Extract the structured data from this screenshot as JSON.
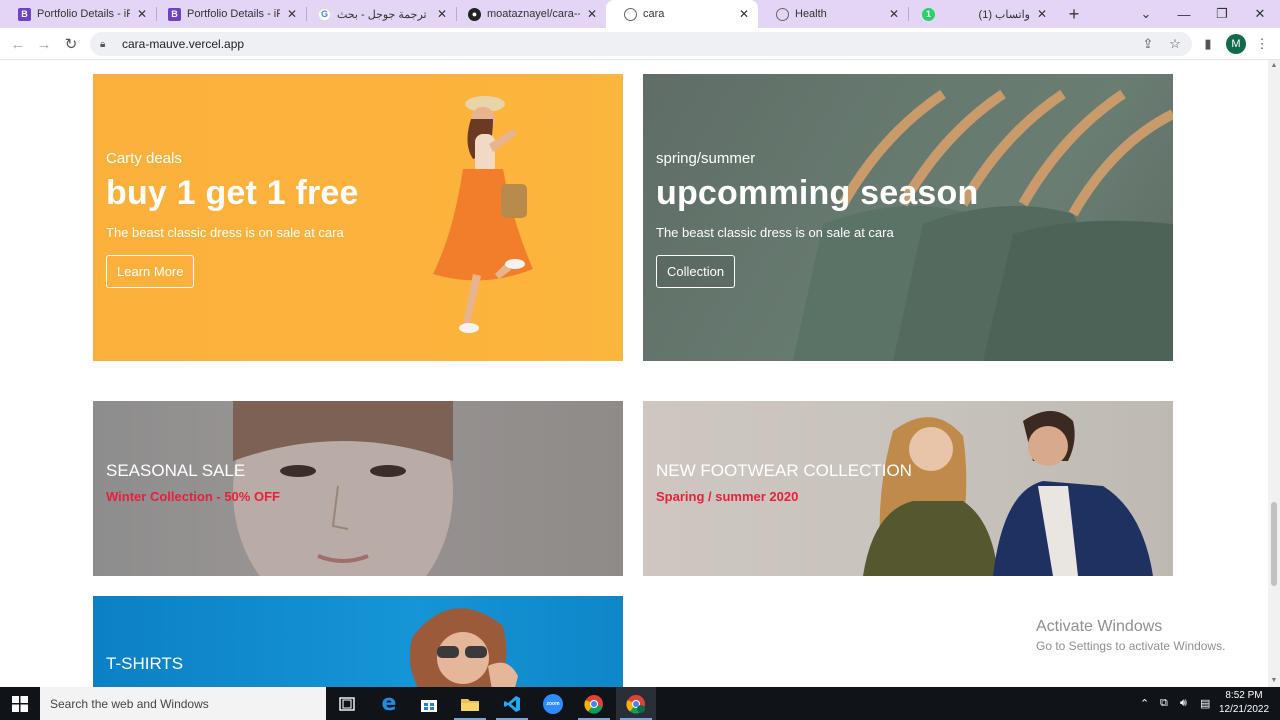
{
  "browser": {
    "tabs": [
      {
        "title": "Portfolio Details - iPor",
        "favicon": "bootstrap-icon",
        "active": false
      },
      {
        "title": "Portfolio Details - iPor",
        "favicon": "bootstrap-icon",
        "active": false
      },
      {
        "title": "ترجمة جوجل - بحث Google",
        "favicon": "google-icon",
        "active": false
      },
      {
        "title": "moataznayel/cara--m",
        "favicon": "github-icon",
        "active": false
      },
      {
        "title": "cara",
        "favicon": "globe-icon",
        "active": true
      },
      {
        "title": "Health",
        "favicon": "globe-icon",
        "active": false
      },
      {
        "title": "(1) واتساب",
        "favicon": "whatsapp-icon",
        "active": false
      }
    ],
    "new_tab_symbol": "+",
    "url": "cara-mauve.vercel.app",
    "profile_initial": "M"
  },
  "banners": {
    "deals": {
      "subtitle": "Carty deals",
      "title": "buy 1 get 1 free",
      "description": "The beast classic dress is on sale at cara",
      "button": "Learn More"
    },
    "season": {
      "subtitle": "spring/summer",
      "title": "upcomming season",
      "description": "The beast classic dress is on sale at cara",
      "button": "Collection"
    },
    "seasonal_sale": {
      "title": "SEASONAL SALE",
      "subtitle": "Winter Collection - 50% OFF"
    },
    "footwear": {
      "title": "NEW FOOTWEAR COLLECTION",
      "subtitle": "Sparing / summer 2020"
    },
    "tshirts": {
      "title": "T-SHIRTS"
    }
  },
  "watermark": {
    "line1": "Activate Windows",
    "line2": "Go to Settings to activate Windows."
  },
  "taskbar": {
    "search_placeholder": "Search the web and Windows",
    "time": "8:52 PM",
    "date": "12/21/2022"
  },
  "colors": {
    "tab_strip": "#e3d6f4",
    "deals_bg": "#fbb13c",
    "season_bg": "#66796f",
    "sale_accent": "#e8203a",
    "taskbar": "#101418"
  }
}
